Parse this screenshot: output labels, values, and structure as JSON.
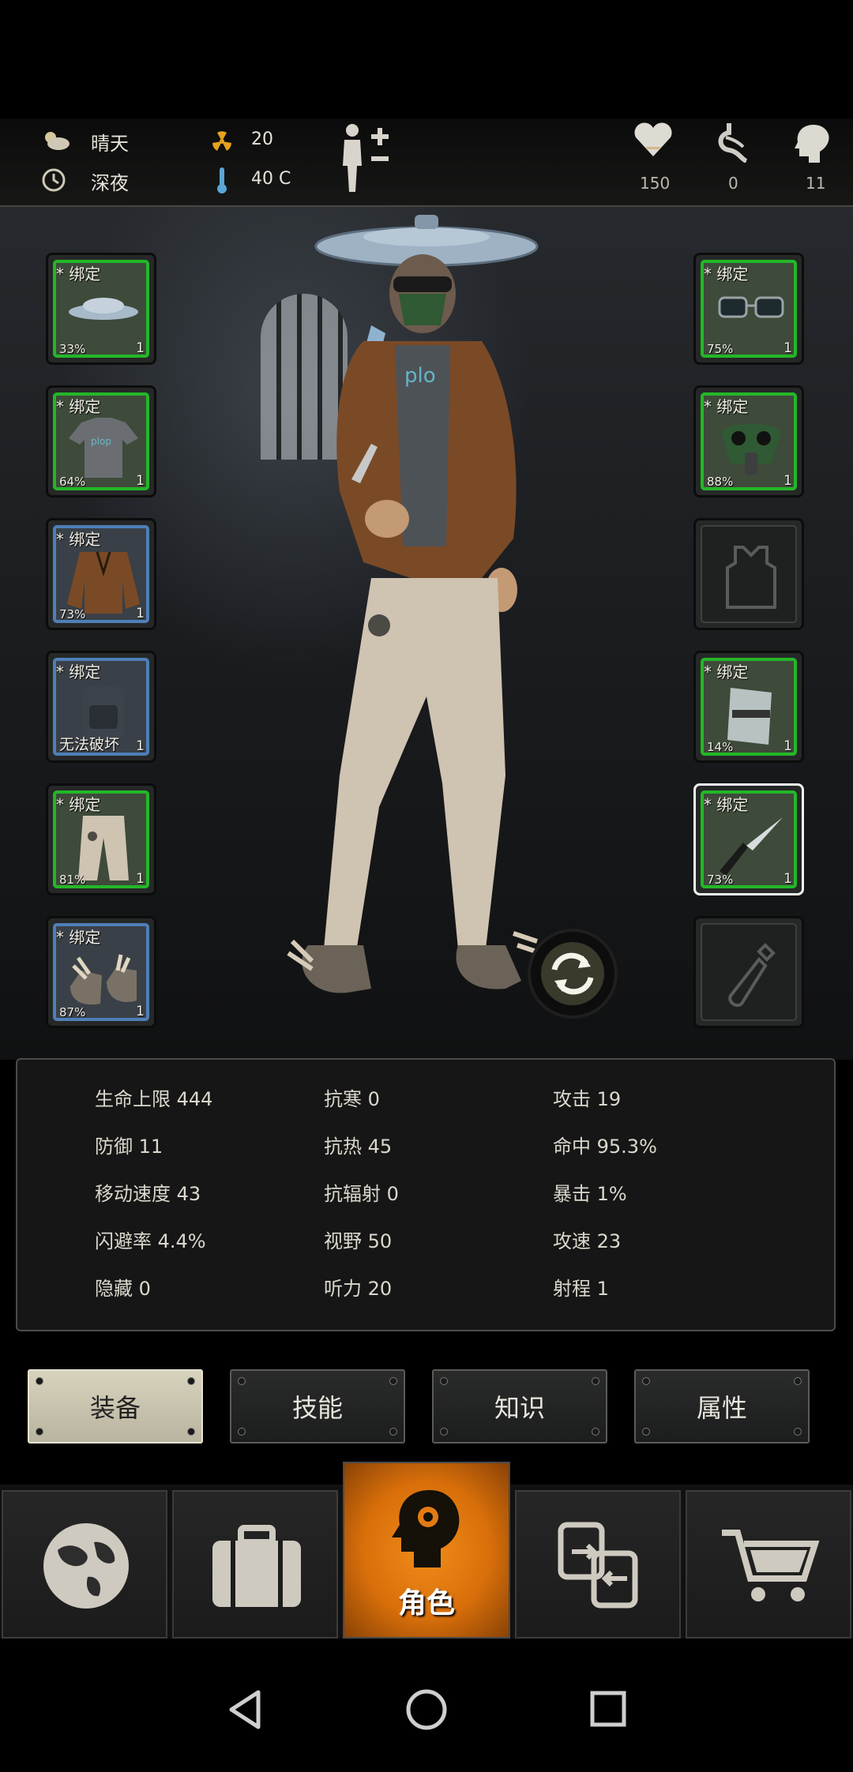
{
  "status": {
    "weather": "晴天",
    "time_of_day": "深夜",
    "radiation": "20",
    "temperature": "40 C",
    "health": "150",
    "stomach": "0",
    "mind": "11"
  },
  "equipment": {
    "left": [
      {
        "label": "* 绑定",
        "pct": "33%",
        "qty": "1",
        "frame": "green",
        "item": "pot-lid-helmet"
      },
      {
        "label": "* 绑定",
        "pct": "64%",
        "qty": "1",
        "frame": "green",
        "item": "tshirt"
      },
      {
        "label": "* 绑定",
        "pct": "73%",
        "qty": "1",
        "frame": "blue",
        "item": "leather-jacket"
      },
      {
        "label": "* 绑定",
        "pct": "无法破坏",
        "qty": "1",
        "frame": "blue",
        "item": "backpack"
      },
      {
        "label": "* 绑定",
        "pct": "81%",
        "qty": "1",
        "frame": "green",
        "item": "pants"
      },
      {
        "label": "* 绑定",
        "pct": "87%",
        "qty": "1",
        "frame": "blue",
        "item": "winged-shoes"
      }
    ],
    "right": [
      {
        "label": "* 绑定",
        "pct": "75%",
        "qty": "1",
        "frame": "green",
        "item": "glasses"
      },
      {
        "label": "* 绑定",
        "pct": "88%",
        "qty": "1",
        "frame": "green",
        "item": "gas-mask"
      },
      {
        "label": "",
        "pct": "",
        "qty": "",
        "frame": "empty",
        "item": "armor-vest-placeholder"
      },
      {
        "label": "* 绑定",
        "pct": "14%",
        "qty": "1",
        "frame": "green",
        "item": "arm-guard"
      },
      {
        "label": "* 绑定",
        "pct": "73%",
        "qty": "1",
        "frame": "green",
        "item": "knife",
        "selected": true
      },
      {
        "label": "",
        "pct": "",
        "qty": "",
        "frame": "empty",
        "item": "molotov-placeholder"
      }
    ]
  },
  "stats": {
    "col1": [
      "生命上限 444",
      "防御 11",
      "移动速度 43",
      "闪避率 4.4%",
      "隐藏 0"
    ],
    "col2": [
      "抗寒 0",
      "抗热 45",
      "抗辐射 0",
      "视野 50",
      "听力 20"
    ],
    "col3": [
      "攻击 19",
      "命中 95.3%",
      "暴击 1%",
      "攻速 23",
      "射程 1"
    ]
  },
  "tabs": [
    "装备",
    "技能",
    "知识",
    "属性"
  ],
  "active_tab": "装备",
  "nav": {
    "active_label": "角色"
  },
  "colors": {
    "accent": "#e07a12",
    "durability_green": "#23b728",
    "durability_blue": "#4e7fb7"
  }
}
